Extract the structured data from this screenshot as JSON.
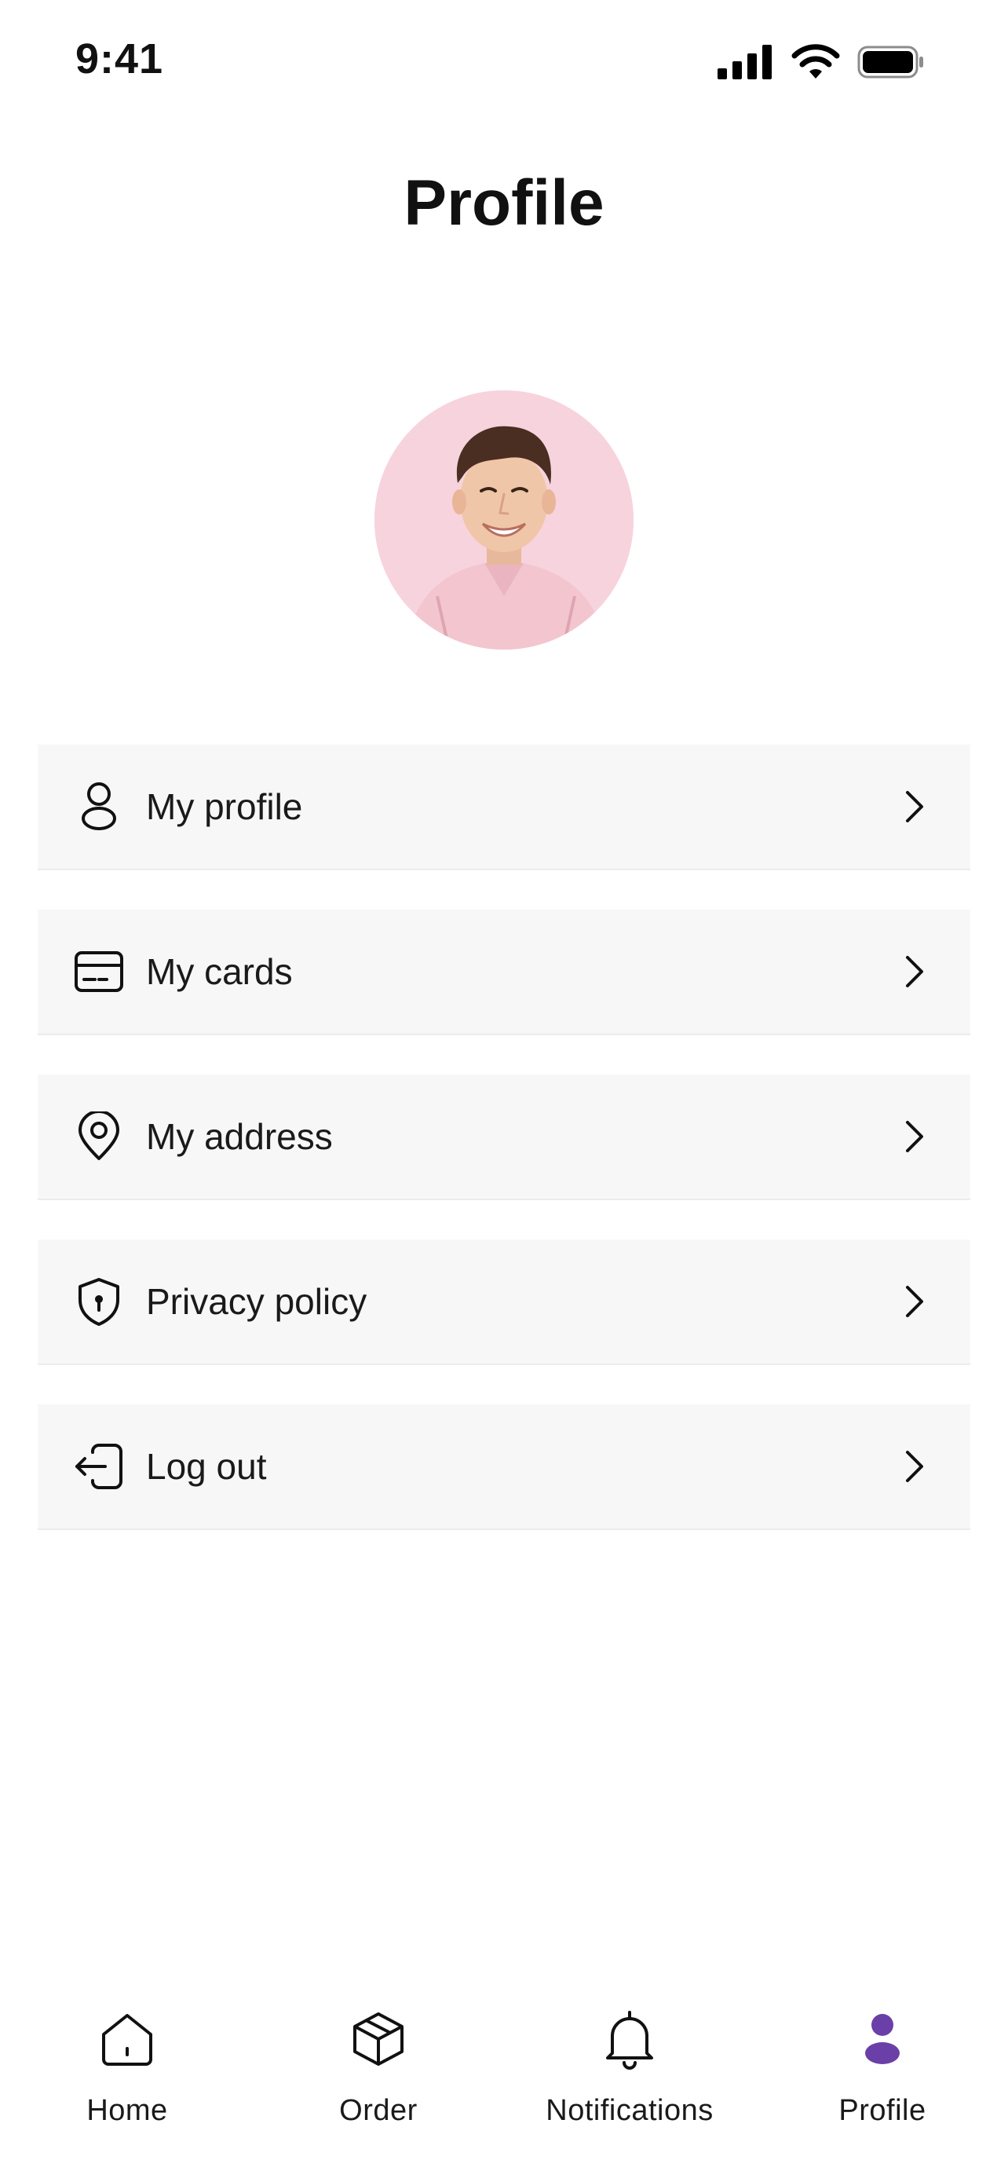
{
  "status_bar": {
    "time": "9:41"
  },
  "header": {
    "title": "Profile"
  },
  "menu": {
    "items": [
      {
        "label": "My profile",
        "icon": "user-icon"
      },
      {
        "label": "My cards",
        "icon": "card-icon"
      },
      {
        "label": "My address",
        "icon": "location-pin-icon"
      },
      {
        "label": "Privacy policy",
        "icon": "shield-icon"
      },
      {
        "label": "Log out",
        "icon": "logout-icon"
      }
    ]
  },
  "tab_bar": {
    "tabs": [
      {
        "label": "Home",
        "icon": "home-icon",
        "active": false
      },
      {
        "label": "Order",
        "icon": "package-icon",
        "active": false
      },
      {
        "label": "Notifications",
        "icon": "bell-icon",
        "active": false
      },
      {
        "label": "Profile",
        "icon": "person-icon",
        "active": true
      }
    ]
  },
  "colors": {
    "accent": "#6b3fa8",
    "row_background": "#f7f7f7",
    "avatar_background": "#f7d3de",
    "text": "#111111"
  }
}
